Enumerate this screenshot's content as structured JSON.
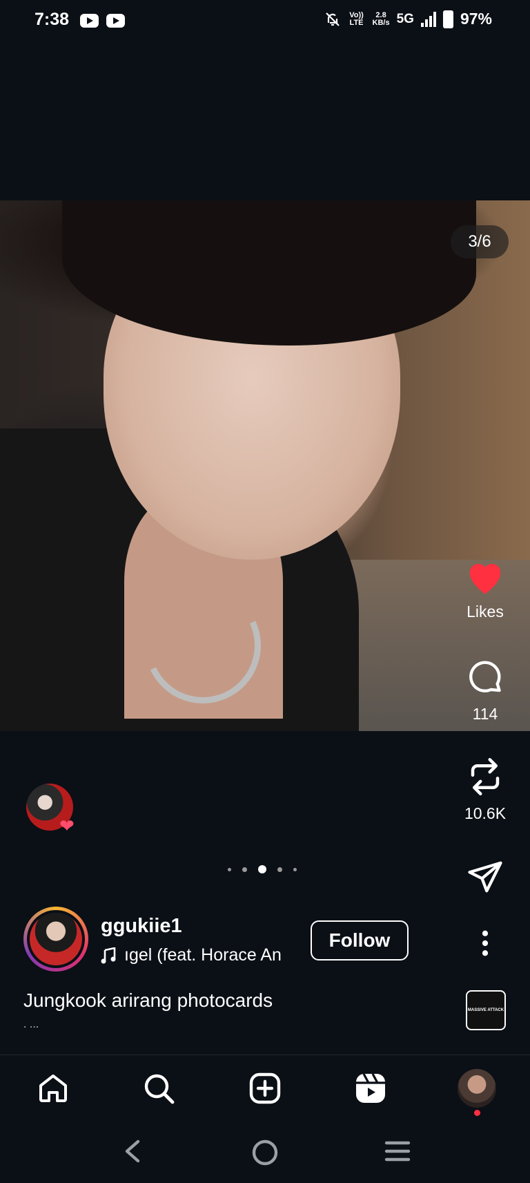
{
  "status_bar": {
    "time": "7:38",
    "notification_icons": [
      "youtube-icon",
      "youtube-icon"
    ],
    "volte": "Vo)) LTE",
    "speed_value": "2.8",
    "speed_unit": "KB/s",
    "network": "5G",
    "battery": "97%"
  },
  "post": {
    "slide_counter": "3/6",
    "carousel": {
      "count": 5,
      "active_index": 2
    },
    "username": "ggukiie1",
    "music": "ıgel (feat. Horace An",
    "follow_label": "Follow",
    "caption": "Jungkook arirang photocards",
    "caption_more": ". ...",
    "audio_thumb_text": "MASSIVE ATTACK"
  },
  "actions": {
    "likes_label": "Likes",
    "comments_count": "114",
    "reposts_count": "10.6K"
  },
  "bottom_nav": {
    "items": [
      "home-icon",
      "search-icon",
      "create-icon",
      "reels-icon",
      "profile-avatar"
    ]
  },
  "colors": {
    "background": "#0b0f16",
    "like_red": "#ff3040",
    "text": "#ffffff"
  }
}
